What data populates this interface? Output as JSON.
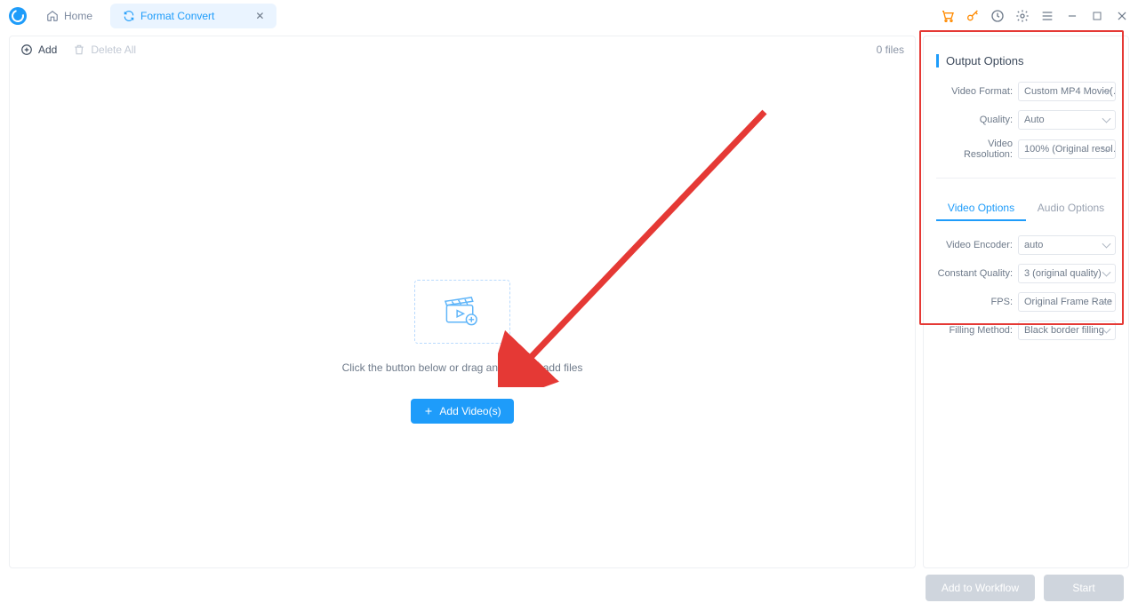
{
  "titlebar": {
    "tabs": {
      "home": "Home",
      "active": "Format Convert"
    }
  },
  "toolbar": {
    "add": "Add",
    "delete_all": "Delete All",
    "file_count": "0 files"
  },
  "empty": {
    "hint": "Click the button below or drag and drop to add files",
    "button": "Add Video(s)"
  },
  "side": {
    "title": "Output Options",
    "video_format_label": "Video Format:",
    "video_format_value": "Custom MP4 Movie(…",
    "quality_label": "Quality:",
    "quality_value": "Auto",
    "resolution_label": "Video Resolution:",
    "resolution_value": "100% (Original resol…",
    "tabs": {
      "video": "Video Options",
      "audio": "Audio Options"
    },
    "encoder_label": "Video Encoder:",
    "encoder_value": "auto",
    "cq_label": "Constant Quality:",
    "cq_value": "3 (original quality)",
    "fps_label": "FPS:",
    "fps_value": "Original Frame Rate",
    "fill_label": "Filling Method:",
    "fill_value": "Black border filling"
  },
  "footer": {
    "workflow": "Add to Workflow",
    "start": "Start"
  }
}
